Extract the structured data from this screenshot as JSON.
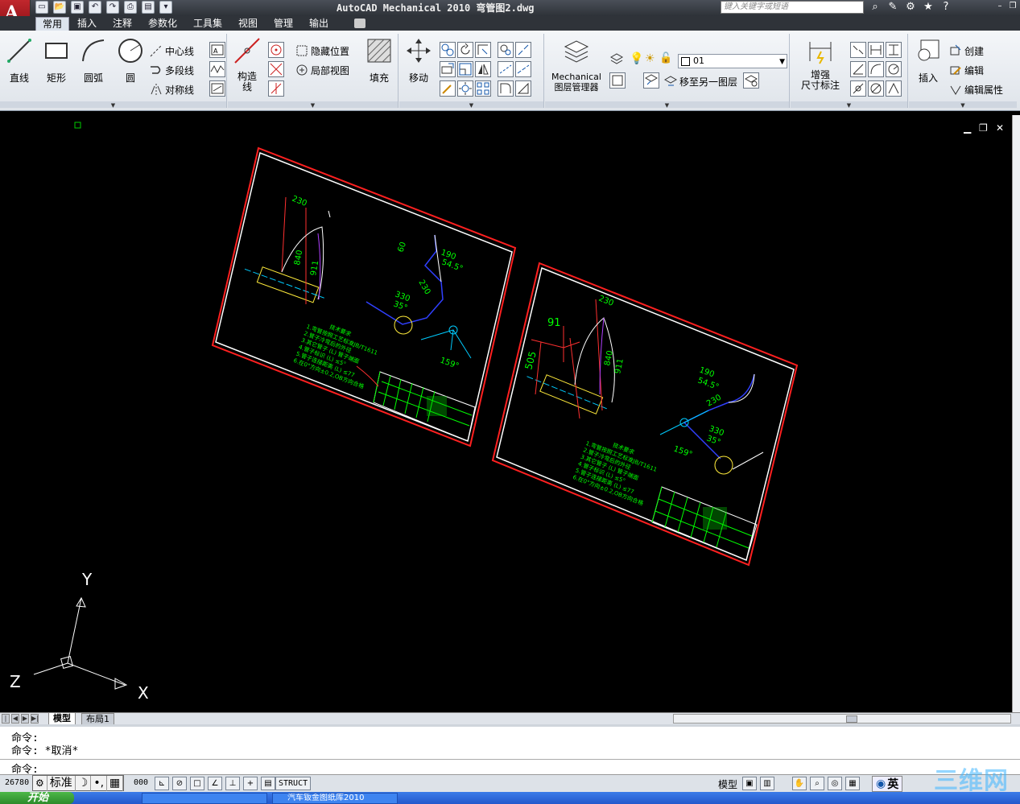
{
  "app": {
    "title": "AutoCAD Mechanical 2010  弯管图2.dwg",
    "logo_badge": "M",
    "search_placeholder": "键入关键字或短语"
  },
  "tabs": [
    "常用",
    "插入",
    "注释",
    "参数化",
    "工具集",
    "视图",
    "管理",
    "输出"
  ],
  "ribbon": {
    "draw": {
      "line": "直线",
      "rect": "矩形",
      "arc": "圆弧",
      "circle": "圆",
      "centerline": "中心线",
      "polyline": "多段线",
      "symline": "对称线"
    },
    "construct": {
      "construct_line": "构造",
      "construct_line2": "线",
      "hide_pos": "隐藏位置",
      "local_view": "局部视图",
      "fill": "填充"
    },
    "modify": {
      "move": "移动"
    },
    "layers": {
      "manager1": "Mechanical",
      "manager2": "图层管理器",
      "current_layer": "01",
      "move_to_layer": "移至另一图层"
    },
    "dims": {
      "enhance1": "增强",
      "enhance2": "尺寸标注"
    },
    "block": {
      "insert": "插入",
      "create": "创建",
      "edit": "编辑",
      "edit_attr": "编辑属性"
    }
  },
  "drawing": {
    "sheet1": {
      "dims": [
        "230",
        "840",
        "911",
        "60",
        "190",
        "54.5°",
        "230",
        "330",
        "35°",
        "159°"
      ],
      "notes_title": "技术要求",
      "notes": [
        "1.弯管按照工艺标准JB/T1611",
        "2.管子冷弯后的外径",
        "3.其它管子 (L) 管子端面",
        "4.管子标识 (L) ≤5°",
        "5.管子连接距离 (L) ≤77",
        "6.在0°方向±0.2,OB方向合格"
      ]
    },
    "sheet2": {
      "dims": [
        "230",
        "91",
        "505",
        "840",
        "911",
        "190",
        "54.5°",
        "230",
        "330",
        "35°",
        "159°"
      ],
      "notes_title": "技术要求",
      "notes": [
        "1.弯管按照工艺标准JB/T1611",
        "2.管子冷弯后的外径",
        "3.其它管子 (L) 管子端面",
        "4.管子标识 (L) ≤5°",
        "5.管子连接距离 (L) ≤77",
        "6.在0°方向±0.2,OB方向合格"
      ]
    },
    "ucs": {
      "x": "X",
      "y": "Y",
      "z": "Z"
    }
  },
  "layout_tabs": [
    "模型",
    "布局1"
  ],
  "command": {
    "line1": "命令:",
    "line2": "命令: *取消*",
    "prompt": "命令:"
  },
  "status": {
    "coords": "26780",
    "coords_tail": "000",
    "ime_label": "标准",
    "struct": "STRUCT",
    "model": "模型",
    "ime2": "英"
  },
  "taskbar": {
    "start": "开始",
    "item": "汽车钣金图纸库2010"
  },
  "watermark": "三维网"
}
